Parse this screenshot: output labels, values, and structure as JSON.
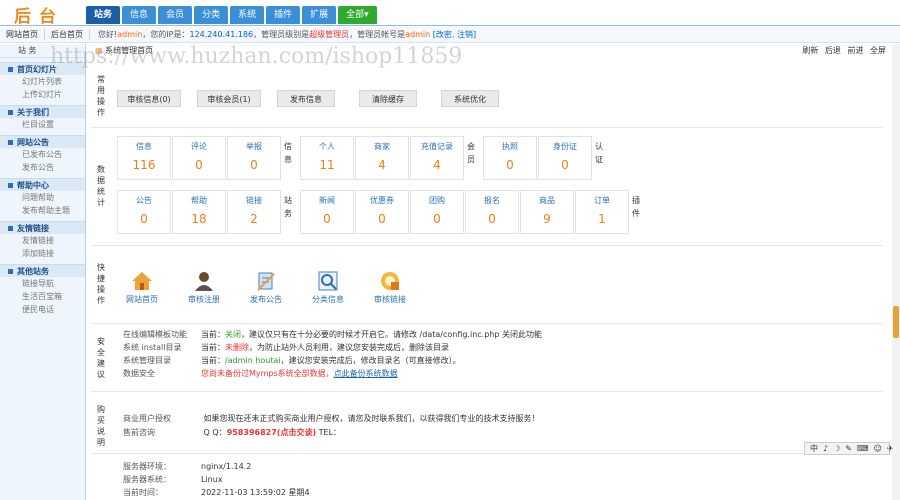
{
  "logo": "后台",
  "nav": {
    "tabs": [
      {
        "label": "站务",
        "active": true
      },
      {
        "label": "信息"
      },
      {
        "label": "会员"
      },
      {
        "label": "分类"
      },
      {
        "label": "系统"
      },
      {
        "label": "插件"
      },
      {
        "label": "扩展"
      },
      {
        "label": "全部▾",
        "green": true
      }
    ]
  },
  "subbar": {
    "links": [
      "网站首页",
      "后台首页"
    ],
    "welcome_pre": "您好!",
    "user": "admin",
    "ip_label": "，您的IP是：",
    "ip": "124.240.41.186",
    "role_label": "，管理员级别是",
    "role": "超级管理员",
    "account_label": "，管理员帐号是",
    "account": "admin",
    "modify": "[改密",
    "logout": "注销]"
  },
  "sidebar": {
    "title": "站 务",
    "groups": [
      {
        "head": "首页幻灯片",
        "items": [
          "幻灯片列表",
          "上传幻灯片"
        ]
      },
      {
        "head": "关于我们",
        "items": [
          "栏目设置"
        ]
      },
      {
        "head": "网站公告",
        "items": [
          "已发布公告",
          "发布公告"
        ]
      },
      {
        "head": "帮助中心",
        "items": [
          "问题帮助",
          "发布帮助主题"
        ]
      },
      {
        "head": "友情链接",
        "items": [
          "友情链接",
          "添加链接"
        ]
      },
      {
        "head": "其他站务",
        "items": [
          "链接导航",
          "生活百宝箱",
          "便民电话"
        ]
      }
    ]
  },
  "main": {
    "title": "系统管理首页",
    "tools": [
      "刷新",
      "后退",
      "前进",
      "全屏"
    ],
    "common_ops": {
      "label": "常用操作",
      "buttons": [
        "审核信息(0)",
        "审核会员(1)",
        "发布信息",
        "清除缓存",
        "系统优化"
      ]
    },
    "stats": {
      "label": "数据统计",
      "row1": {
        "groups": [
          {
            "name": "信息",
            "items": [
              {
                "label": "信息",
                "value": "116"
              },
              {
                "label": "评论",
                "value": "0"
              },
              {
                "label": "举报",
                "value": "0"
              }
            ]
          },
          {
            "name": "会员",
            "items": [
              {
                "label": "个人",
                "value": "11"
              },
              {
                "label": "商家",
                "value": "4"
              },
              {
                "label": "充值记录",
                "value": "4"
              }
            ]
          },
          {
            "name": "认证",
            "items": [
              {
                "label": "执照",
                "value": "0"
              },
              {
                "label": "身份证",
                "value": "0"
              }
            ]
          }
        ]
      },
      "row2": {
        "groups": [
          {
            "name": "站务",
            "items": [
              {
                "label": "公告",
                "value": "0"
              },
              {
                "label": "帮助",
                "value": "18"
              },
              {
                "label": "链接",
                "value": "2"
              }
            ]
          },
          {
            "name": "插件",
            "items": [
              {
                "label": "新闻",
                "value": "0"
              },
              {
                "label": "优惠券",
                "value": "0"
              },
              {
                "label": "团购",
                "value": "0"
              },
              {
                "label": "报名",
                "value": "0"
              },
              {
                "label": "商品",
                "value": "9"
              },
              {
                "label": "订单",
                "value": "1"
              }
            ]
          }
        ]
      }
    },
    "quick": {
      "label": "快捷操作",
      "items": [
        {
          "label": "网站首页",
          "icon": "home-icon"
        },
        {
          "label": "审核注册",
          "icon": "user-icon"
        },
        {
          "label": "发布公告",
          "icon": "notice-icon"
        },
        {
          "label": "分类信息",
          "icon": "search-icon"
        },
        {
          "label": "审核链接",
          "icon": "link-icon"
        }
      ]
    },
    "security": {
      "label": "安全建议",
      "rows": [
        {
          "key": "在线编辑模板功能",
          "pre": "当前：",
          "status": "关闭",
          "status_color": "green",
          "rest": "，建议仅只有在十分必要的时候才开启它。请修改 /data/config.inc.php 关闭此功能"
        },
        {
          "key": "系统 install目录",
          "pre": "当前：",
          "status": "未删除",
          "status_color": "red",
          "rest": "，为防止站外人员利用，建议您安装完成后，删除该目录"
        },
        {
          "key": "系统管理目录",
          "pre": "当前：",
          "status": "/admin houtai",
          "status_color": "green",
          "rest": "，建议您安装完成后，修改目录名（可直接修改）。"
        },
        {
          "key": "数据安全",
          "pre": "",
          "status": "您尚未备份过Mymps系统全部数据，",
          "status_color": "red",
          "rest": "点此备份系统数据",
          "rest_color": "blue"
        }
      ]
    },
    "purchase": {
      "label": "购买说明",
      "rows": [
        {
          "key": "商业用户授权",
          "value": "如果您现在还未正式购买商业用户授权，请您及时联系我们，以获得我们专业的技术支持服务！"
        },
        {
          "key": "售前咨询",
          "value": "Q Q：",
          "qq": "958396827(点击交谈)",
          "tel": " TEL："
        }
      ]
    },
    "server": {
      "rows": [
        {
          "key": "服务器环境：",
          "value": "nginx/1.14.2"
        },
        {
          "key": "服务器系统：",
          "value": "Linux"
        },
        {
          "key": "当前时间：",
          "value": "2022-11-03 13:59:02 星期4"
        }
      ]
    }
  },
  "ime": [
    "中",
    "♪",
    "☽",
    "✎",
    "⌨",
    "☺",
    "✈"
  ],
  "watermark": "https://www.huzhan.com/ishop11859"
}
